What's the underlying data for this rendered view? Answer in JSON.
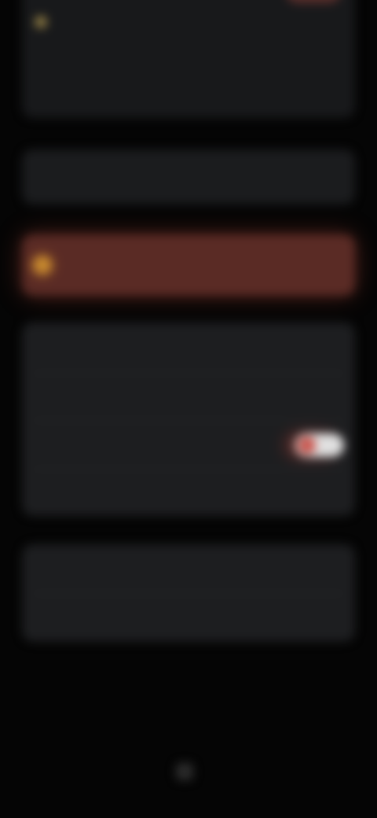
{
  "top_card": {
    "top_line": "",
    "value": "",
    "footer": ""
  },
  "bar_card": {
    "label": "",
    "value": ""
  },
  "alert": {
    "message": ""
  },
  "settings": {
    "rows": [
      "",
      "",
      "",
      ""
    ],
    "toggle_state": "on"
  },
  "more": {
    "rows": [
      "",
      ""
    ]
  },
  "note": {
    "text": "",
    "link": ""
  },
  "footer": {
    "label": ""
  },
  "colors": {
    "alert_bg": "#5a2b25",
    "accent": "#c84f47",
    "warning": "#c7892e"
  }
}
